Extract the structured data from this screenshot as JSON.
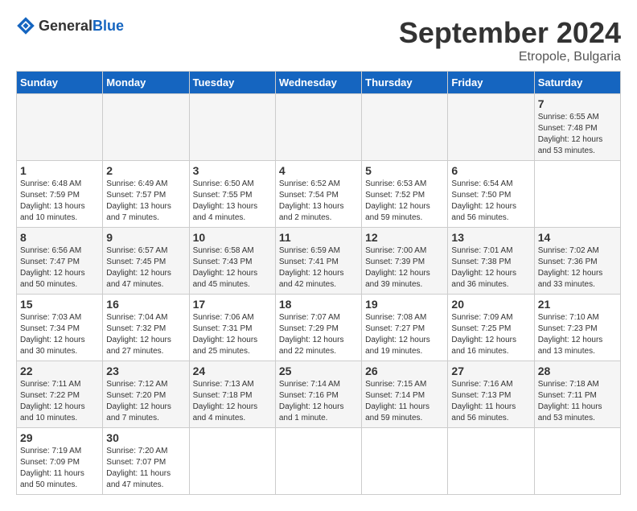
{
  "app": {
    "name_general": "General",
    "name_blue": "Blue"
  },
  "calendar": {
    "month_year": "September 2024",
    "location": "Etropole, Bulgaria",
    "days_of_week": [
      "Sunday",
      "Monday",
      "Tuesday",
      "Wednesday",
      "Thursday",
      "Friday",
      "Saturday"
    ],
    "weeks": [
      [
        null,
        null,
        null,
        null,
        null,
        null,
        {
          "day": "7",
          "sunrise": "Sunrise: 6:55 AM",
          "sunset": "Sunset: 7:48 PM",
          "daylight": "Daylight: 12 hours and 53 minutes."
        }
      ],
      [
        {
          "day": "1",
          "sunrise": "Sunrise: 6:48 AM",
          "sunset": "Sunset: 7:59 PM",
          "daylight": "Daylight: 13 hours and 10 minutes."
        },
        {
          "day": "2",
          "sunrise": "Sunrise: 6:49 AM",
          "sunset": "Sunset: 7:57 PM",
          "daylight": "Daylight: 13 hours and 7 minutes."
        },
        {
          "day": "3",
          "sunrise": "Sunrise: 6:50 AM",
          "sunset": "Sunset: 7:55 PM",
          "daylight": "Daylight: 13 hours and 4 minutes."
        },
        {
          "day": "4",
          "sunrise": "Sunrise: 6:52 AM",
          "sunset": "Sunset: 7:54 PM",
          "daylight": "Daylight: 13 hours and 2 minutes."
        },
        {
          "day": "5",
          "sunrise": "Sunrise: 6:53 AM",
          "sunset": "Sunset: 7:52 PM",
          "daylight": "Daylight: 12 hours and 59 minutes."
        },
        {
          "day": "6",
          "sunrise": "Sunrise: 6:54 AM",
          "sunset": "Sunset: 7:50 PM",
          "daylight": "Daylight: 12 hours and 56 minutes."
        },
        null
      ],
      [
        {
          "day": "8",
          "sunrise": "Sunrise: 6:56 AM",
          "sunset": "Sunset: 7:47 PM",
          "daylight": "Daylight: 12 hours and 50 minutes."
        },
        {
          "day": "9",
          "sunrise": "Sunrise: 6:57 AM",
          "sunset": "Sunset: 7:45 PM",
          "daylight": "Daylight: 12 hours and 47 minutes."
        },
        {
          "day": "10",
          "sunrise": "Sunrise: 6:58 AM",
          "sunset": "Sunset: 7:43 PM",
          "daylight": "Daylight: 12 hours and 45 minutes."
        },
        {
          "day": "11",
          "sunrise": "Sunrise: 6:59 AM",
          "sunset": "Sunset: 7:41 PM",
          "daylight": "Daylight: 12 hours and 42 minutes."
        },
        {
          "day": "12",
          "sunrise": "Sunrise: 7:00 AM",
          "sunset": "Sunset: 7:39 PM",
          "daylight": "Daylight: 12 hours and 39 minutes."
        },
        {
          "day": "13",
          "sunrise": "Sunrise: 7:01 AM",
          "sunset": "Sunset: 7:38 PM",
          "daylight": "Daylight: 12 hours and 36 minutes."
        },
        {
          "day": "14",
          "sunrise": "Sunrise: 7:02 AM",
          "sunset": "Sunset: 7:36 PM",
          "daylight": "Daylight: 12 hours and 33 minutes."
        }
      ],
      [
        {
          "day": "15",
          "sunrise": "Sunrise: 7:03 AM",
          "sunset": "Sunset: 7:34 PM",
          "daylight": "Daylight: 12 hours and 30 minutes."
        },
        {
          "day": "16",
          "sunrise": "Sunrise: 7:04 AM",
          "sunset": "Sunset: 7:32 PM",
          "daylight": "Daylight: 12 hours and 27 minutes."
        },
        {
          "day": "17",
          "sunrise": "Sunrise: 7:06 AM",
          "sunset": "Sunset: 7:31 PM",
          "daylight": "Daylight: 12 hours and 25 minutes."
        },
        {
          "day": "18",
          "sunrise": "Sunrise: 7:07 AM",
          "sunset": "Sunset: 7:29 PM",
          "daylight": "Daylight: 12 hours and 22 minutes."
        },
        {
          "day": "19",
          "sunrise": "Sunrise: 7:08 AM",
          "sunset": "Sunset: 7:27 PM",
          "daylight": "Daylight: 12 hours and 19 minutes."
        },
        {
          "day": "20",
          "sunrise": "Sunrise: 7:09 AM",
          "sunset": "Sunset: 7:25 PM",
          "daylight": "Daylight: 12 hours and 16 minutes."
        },
        {
          "day": "21",
          "sunrise": "Sunrise: 7:10 AM",
          "sunset": "Sunset: 7:23 PM",
          "daylight": "Daylight: 12 hours and 13 minutes."
        }
      ],
      [
        {
          "day": "22",
          "sunrise": "Sunrise: 7:11 AM",
          "sunset": "Sunset: 7:22 PM",
          "daylight": "Daylight: 12 hours and 10 minutes."
        },
        {
          "day": "23",
          "sunrise": "Sunrise: 7:12 AM",
          "sunset": "Sunset: 7:20 PM",
          "daylight": "Daylight: 12 hours and 7 minutes."
        },
        {
          "day": "24",
          "sunrise": "Sunrise: 7:13 AM",
          "sunset": "Sunset: 7:18 PM",
          "daylight": "Daylight: 12 hours and 4 minutes."
        },
        {
          "day": "25",
          "sunrise": "Sunrise: 7:14 AM",
          "sunset": "Sunset: 7:16 PM",
          "daylight": "Daylight: 12 hours and 1 minute."
        },
        {
          "day": "26",
          "sunrise": "Sunrise: 7:15 AM",
          "sunset": "Sunset: 7:14 PM",
          "daylight": "Daylight: 11 hours and 59 minutes."
        },
        {
          "day": "27",
          "sunrise": "Sunrise: 7:16 AM",
          "sunset": "Sunset: 7:13 PM",
          "daylight": "Daylight: 11 hours and 56 minutes."
        },
        {
          "day": "28",
          "sunrise": "Sunrise: 7:18 AM",
          "sunset": "Sunset: 7:11 PM",
          "daylight": "Daylight: 11 hours and 53 minutes."
        }
      ],
      [
        {
          "day": "29",
          "sunrise": "Sunrise: 7:19 AM",
          "sunset": "Sunset: 7:09 PM",
          "daylight": "Daylight: 11 hours and 50 minutes."
        },
        {
          "day": "30",
          "sunrise": "Sunrise: 7:20 AM",
          "sunset": "Sunset: 7:07 PM",
          "daylight": "Daylight: 11 hours and 47 minutes."
        },
        null,
        null,
        null,
        null,
        null
      ]
    ]
  }
}
